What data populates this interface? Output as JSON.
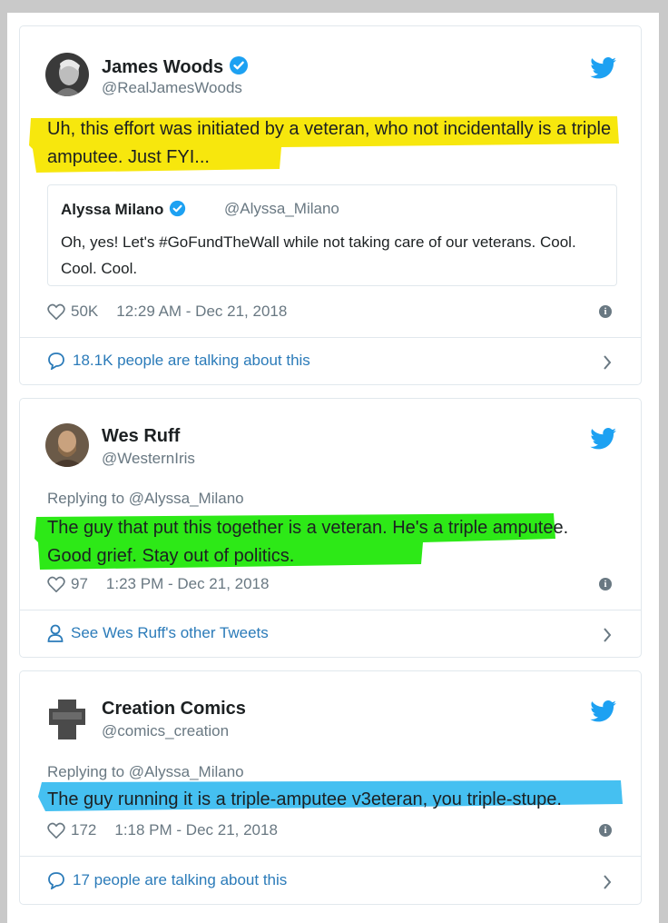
{
  "tweets": [
    {
      "name": "James Woods",
      "handle": "@RealJamesWoods",
      "verified": true,
      "text": "Uh, this effort was initiated by a veteran, who not incidentally is a triple amputee. Just FYI...",
      "highlight_color": "#f7e600",
      "quote": {
        "name": "Alyssa Milano",
        "handle": "@Alyssa_Milano",
        "text": "Oh, yes! Let's #GoFundTheWall while not taking care of our veterans. Cool. Cool. Cool."
      },
      "likes": "50K",
      "timestamp": "12:29 AM - Dec 21, 2018",
      "footer": "18.1K people are talking about this",
      "footer_icon": "speech-bubble-icon"
    },
    {
      "name": "Wes Ruff",
      "handle": "@WesternIris",
      "verified": false,
      "replying_to": "Replying to @Alyssa_Milano",
      "text": "The guy that put this together is a veteran. He's a triple amputee. Good grief. Stay out of politics.",
      "highlight_color": "#22e80b",
      "likes": "97",
      "timestamp": "1:23 PM - Dec 21, 2018",
      "footer": "See Wes Ruff's other Tweets",
      "footer_icon": "person-icon"
    },
    {
      "name": "Creation Comics",
      "handle": "@comics_creation",
      "verified": false,
      "replying_to": "Replying to @Alyssa_Milano",
      "text": "The guy running it is a triple-amputee v3eteran, you triple-stupe.",
      "highlight_color": "#3bbdf0",
      "likes": "172",
      "timestamp": "1:18 PM - Dec 21, 2018",
      "footer": "17 people are talking about this",
      "footer_icon": "speech-bubble-icon"
    }
  ],
  "colors": {
    "link": "#2b7bb9",
    "muted": "#697882",
    "twitter_blue": "#1da1f2"
  }
}
